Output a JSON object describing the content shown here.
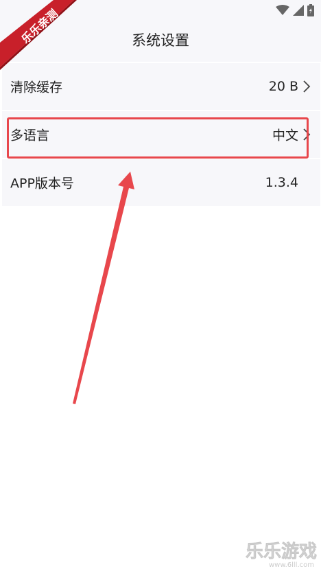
{
  "nav": {
    "title": "系统设置"
  },
  "settings": {
    "items": [
      {
        "label": "清除缓存",
        "value": "20 B",
        "has_chevron": true
      },
      {
        "label": "多语言",
        "value": "中文",
        "has_chevron": true
      },
      {
        "label": "APP版本号",
        "value": "1.3.4",
        "has_chevron": false
      }
    ]
  },
  "icons": {
    "status": [
      "wifi-icon",
      "cellular-signal-icon",
      "battery-icon"
    ],
    "back": "back-arrow-icon",
    "chevron": "chevron-right-icon"
  },
  "annotations": {
    "highlight_color": "#e8474c",
    "arrow_color": "#e8474c"
  },
  "watermarks": {
    "corner_ribbon_text": "乐乐亲测",
    "bottom_logo_text": "乐乐游戏",
    "bottom_logo_url": "www.6lll.com"
  },
  "colors": {
    "background": "#ffffff",
    "row_background": "#f7f7fa",
    "text": "#222222"
  }
}
